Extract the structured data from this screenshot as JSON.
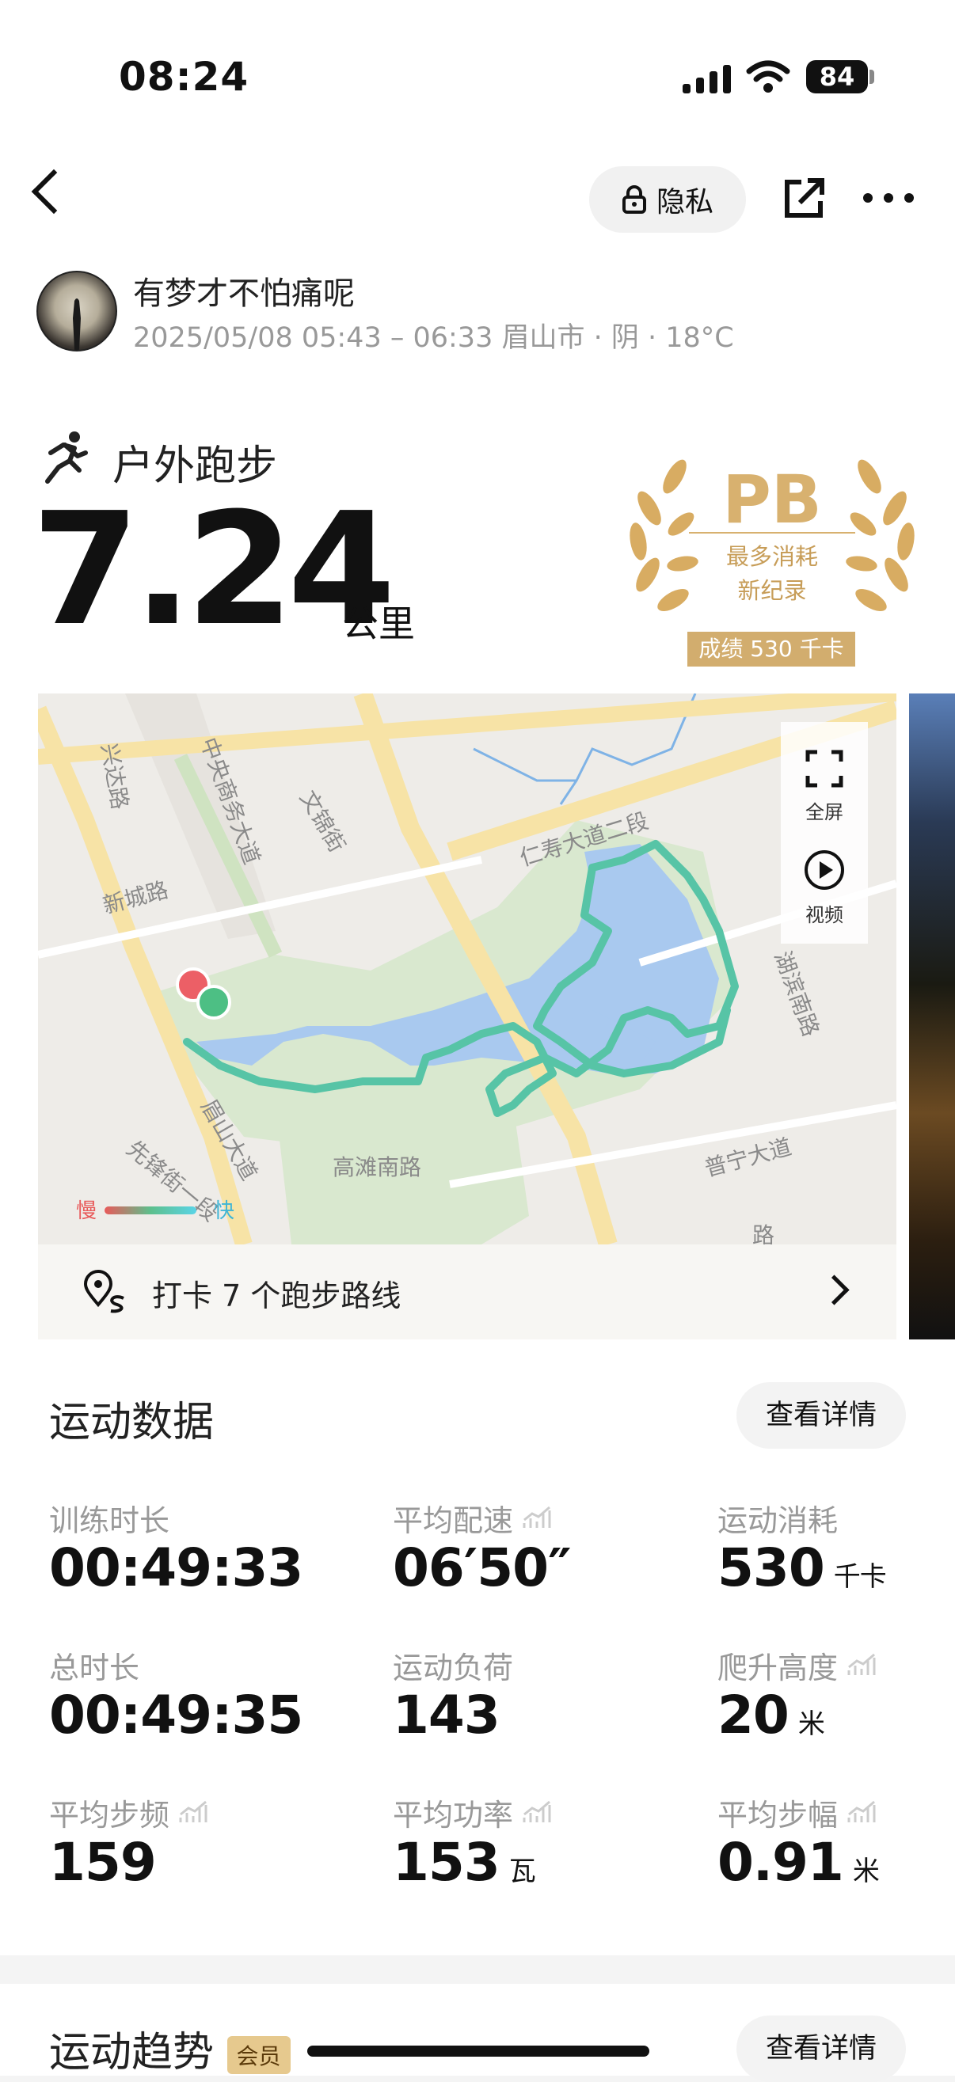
{
  "status_bar": {
    "time": "08:24",
    "battery": "84"
  },
  "header": {
    "privacy_label": "隐私"
  },
  "user": {
    "name": "有梦才不怕痛呢",
    "info": "2025/05/08 05:43 – 06:33 眉山市 · 阴 · 18°C"
  },
  "workout": {
    "type": "户外跑步",
    "distance": "7.24",
    "unit": "公里"
  },
  "badge": {
    "title": "PB",
    "line1": "最多消耗",
    "line2": "新纪录",
    "score": "成绩 530 千卡"
  },
  "map": {
    "fullscreen_label": "全屏",
    "video_label": "视频",
    "legend_slow": "慢",
    "legend_fast": "快",
    "roads": [
      "兴达路",
      "中央商务大道",
      "文锦街",
      "新城路",
      "仁寿大道二段",
      "湖滨南路",
      "眉山大道",
      "先锋街一段",
      "高滩南路",
      "普宁大道",
      "路"
    ],
    "checkin": "打卡 7 个跑步路线"
  },
  "stats": {
    "title": "运动数据",
    "detail_button": "查看详情",
    "items": [
      {
        "label": "训练时长",
        "value": "00:49:33",
        "unit": ""
      },
      {
        "label": "平均配速",
        "value": "06′50″",
        "unit": ""
      },
      {
        "label": "运动消耗",
        "value": "530",
        "unit": "千卡"
      },
      {
        "label": "总时长",
        "value": "00:49:35",
        "unit": ""
      },
      {
        "label": "运动负荷",
        "value": "143",
        "unit": ""
      },
      {
        "label": "爬升高度",
        "value": "20",
        "unit": "米"
      },
      {
        "label": "平均步频",
        "value": "159",
        "unit": ""
      },
      {
        "label": "平均功率",
        "value": "153",
        "unit": "瓦"
      },
      {
        "label": "平均步幅",
        "value": "0.91",
        "unit": "米"
      }
    ]
  },
  "trend": {
    "title": "运动趋势",
    "vip_badge": "会员",
    "detail_button": "查看详情"
  },
  "colors": {
    "gold": "#d8b16f",
    "route": "#4cc3a0",
    "slow": "#e85a5a",
    "fast": "#5ad4e6"
  }
}
